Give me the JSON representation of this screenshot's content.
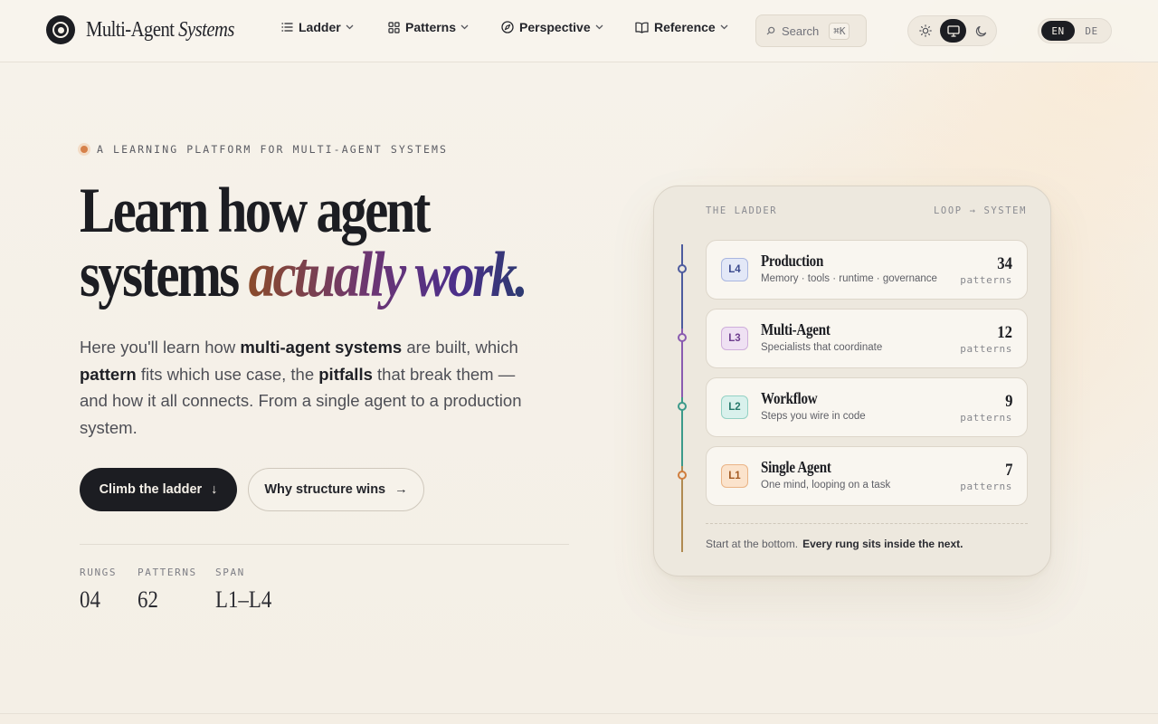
{
  "header": {
    "brand": {
      "name": "Multi-Agent",
      "name_italic": "Systems"
    },
    "nav": [
      {
        "label": "Ladder",
        "icon": "list-icon"
      },
      {
        "label": "Patterns",
        "icon": "grid-icon"
      },
      {
        "label": "Perspective",
        "icon": "compass-icon"
      },
      {
        "label": "Reference",
        "icon": "book-icon"
      }
    ],
    "search": {
      "label": "Search",
      "shortcut": "⌘K"
    },
    "theme": {
      "options": [
        "light",
        "system",
        "dark"
      ],
      "active": "system"
    },
    "language": {
      "options": [
        "EN",
        "DE"
      ],
      "active": "EN"
    }
  },
  "hero": {
    "eyebrow": "A LEARNING PLATFORM FOR MULTI-AGENT SYSTEMS",
    "headline_line1": "Learn how agent",
    "headline_line2_plain": "systems",
    "headline_line2_accent": "actually work.",
    "lede": {
      "p1": "Here you'll learn how ",
      "b1": "multi-agent systems",
      "p2": " are built, which ",
      "b2": "pattern",
      "p3": " fits which use case, the ",
      "b3": "pitfalls",
      "p4": " that break them — and how it all connects. From a single agent to a production system."
    },
    "primary_button": {
      "label": "Climb the ladder",
      "arrow": "↓"
    },
    "secondary_button": {
      "label": "Why structure wins",
      "arrow": "→"
    },
    "stats": [
      {
        "key": "RUNGS",
        "value": "04"
      },
      {
        "key": "PATTERNS",
        "value": "62"
      },
      {
        "key": "SPAN",
        "value": "L1–L4"
      }
    ]
  },
  "ladder": {
    "heading": "THE LADDER",
    "direction": "LOOP → SYSTEM",
    "rungs": [
      {
        "badge": "L4",
        "title": "Production",
        "subtitle": "Memory · tools · runtime · governance",
        "count": "34",
        "unit": "patterns",
        "color": "#4d5b9e",
        "badge_bg": "#e3e8f7",
        "badge_border": "#a9b6e0"
      },
      {
        "badge": "L3",
        "title": "Multi-Agent",
        "subtitle": "Specialists that coordinate",
        "count": "12",
        "unit": "patterns",
        "color": "#8a5bb0",
        "badge_bg": "#efe1f3",
        "badge_border": "#cfaedb"
      },
      {
        "badge": "L2",
        "title": "Workflow",
        "subtitle": "Steps you wire in code",
        "count": "9",
        "unit": "patterns",
        "color": "#3c9a8a",
        "badge_bg": "#d9f1ec",
        "badge_border": "#94d1c4"
      },
      {
        "badge": "L1",
        "title": "Single Agent",
        "subtitle": "One mind, looping on a task",
        "count": "7",
        "unit": "patterns",
        "color": "#d07d3c",
        "badge_bg": "#fbe3cc",
        "badge_border": "#eab486"
      }
    ],
    "footer_plain": "Start at the bottom.",
    "footer_bold": "Every rung sits inside the next."
  }
}
